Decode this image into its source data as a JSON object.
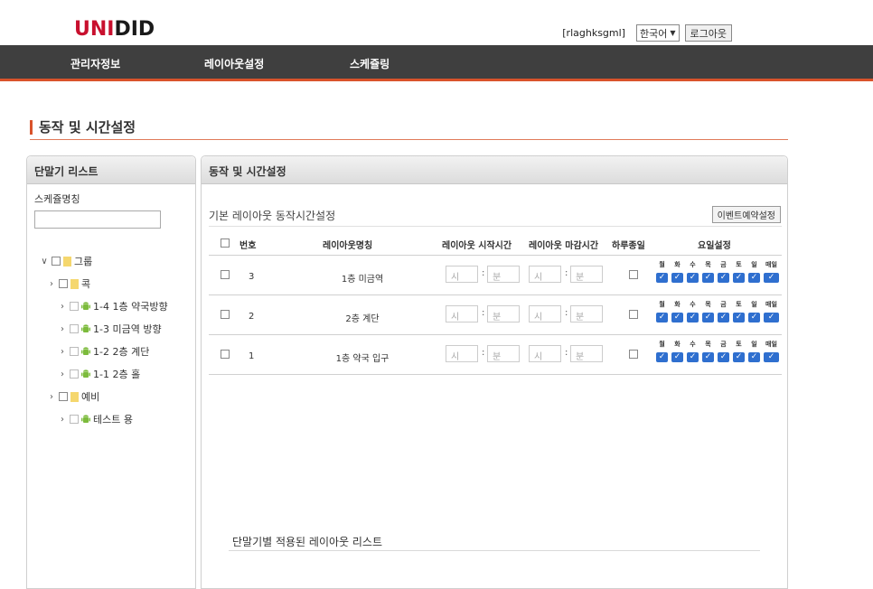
{
  "header": {
    "logo_a": "UNI",
    "logo_b": "DID",
    "user_id": "[rlaghksgml]",
    "language": "한국어",
    "logout_label": "로그아웃"
  },
  "nav": {
    "items": [
      "관리자정보",
      "레이아웃설정",
      "스케쥴링"
    ]
  },
  "page": {
    "title": "동작 및 시간설정"
  },
  "left_panel": {
    "title": "단말기 리스트",
    "schedule_label": "스케쥴명칭",
    "schedule_value": "",
    "tree": [
      {
        "label": "그룹",
        "type": "folder",
        "expanded": true
      },
      {
        "label": "콕",
        "type": "folder"
      },
      {
        "label": "1-4 1층 약국방향",
        "type": "device"
      },
      {
        "label": "1-3 미금역 방향",
        "type": "device"
      },
      {
        "label": "1-2 2층 계단",
        "type": "device"
      },
      {
        "label": "1-1 2층 홀",
        "type": "device"
      },
      {
        "label": "예비",
        "type": "folder"
      },
      {
        "label": "테스트 용",
        "type": "device"
      }
    ]
  },
  "right_panel": {
    "title": "동작 및 시간설정",
    "subtitle": "기본 레이아웃 동작시간설정",
    "event_button": "이벤트예약설정",
    "columns": [
      "번호",
      "레이아웃명칭",
      "레이아웃 시작시간",
      "레이아웃 마감시간",
      "하루종일",
      "요일설정"
    ],
    "hour_placeholder": "시",
    "minute_placeholder": "분",
    "day_labels": [
      "월",
      "화",
      "수",
      "목",
      "금",
      "토",
      "일",
      "매일"
    ],
    "rows": [
      {
        "num": "3",
        "name": "1층 미금역"
      },
      {
        "num": "2",
        "name": "2층 계단"
      },
      {
        "num": "1",
        "name": "1층 약국 입구"
      }
    ],
    "list_title": "단말기별 적용된 레이아웃 리스트"
  },
  "colors": {
    "accent": "#d9532b",
    "nav_bg": "#3f3f3f",
    "logo_red": "#c8102e",
    "check_blue": "#2f6fcf"
  }
}
